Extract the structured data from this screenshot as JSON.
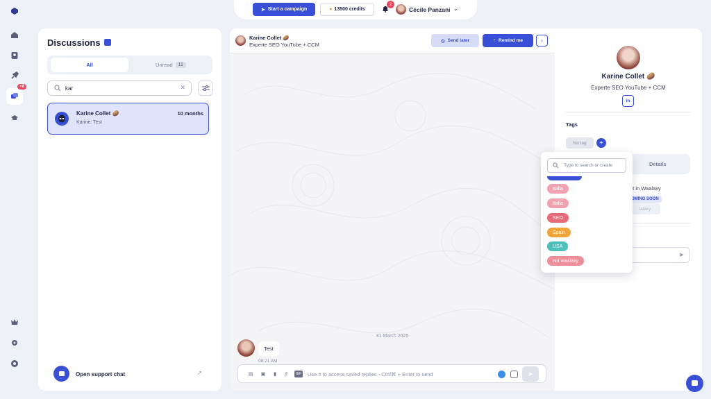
{
  "nav": {
    "icons": [
      "logo-icon",
      "home-icon",
      "contacts-icon",
      "rocket-icon",
      "messages-icon",
      "academy-icon",
      "crown-icon",
      "gear-icon",
      "help-icon"
    ],
    "messages_badge": "+8"
  },
  "topbar": {
    "campaign_label": "Start a campaign",
    "credits_label": "13500 credits",
    "notifications_count": "2",
    "user_name": "Cécile Panzani"
  },
  "discussions": {
    "title": "Discussions",
    "tabs": [
      {
        "label": "All",
        "active": true
      },
      {
        "label": "Unread",
        "count": "11"
      }
    ],
    "search_value": "kar",
    "conversations": [
      {
        "name": "Karine Collet 🥔",
        "time": "10 months",
        "preview": "Karine: Test"
      }
    ],
    "support_label": "Open support chat"
  },
  "chat": {
    "contact_name": "Karine Collet 🥔",
    "contact_title": "Experte SEO YouTube + CCM",
    "send_later_label": "Send later",
    "remind_label": "Remind me",
    "date_separator": "31 March 2025",
    "messages": [
      {
        "text": "Test",
        "time": "08:21 AM"
      }
    ],
    "composer_placeholder": "Use # to access saved replies - Ctrl/⌘ + Enter to send"
  },
  "profile": {
    "name": "Karine Collet 🥔",
    "title": "Experte SEO YouTube + CCM",
    "linkedin_label": "in",
    "tags_heading": "Tags",
    "no_tag_label": "No tag",
    "details_tab": "Details",
    "not_in_text": "ot in Waalaxy",
    "coming_soon": "OMING SOON"
  },
  "tag_dropdown": {
    "placeholder": "Type to search or create",
    "tags": [
      {
        "label": "Italia",
        "color": "#f0a2b0"
      },
      {
        "label": "Italia",
        "color": "#f0a2b0"
      },
      {
        "label": "SEO",
        "color": "#e76a78"
      },
      {
        "label": "Spain",
        "color": "#f0a43a"
      },
      {
        "label": "USA",
        "color": "#4cc0b8"
      },
      {
        "label": "not waalaxy",
        "color": "#ec8f99"
      }
    ]
  },
  "colors": {
    "primary": "#3a4fd8",
    "badge": "#e84a5f",
    "background": "#eef0f7"
  }
}
